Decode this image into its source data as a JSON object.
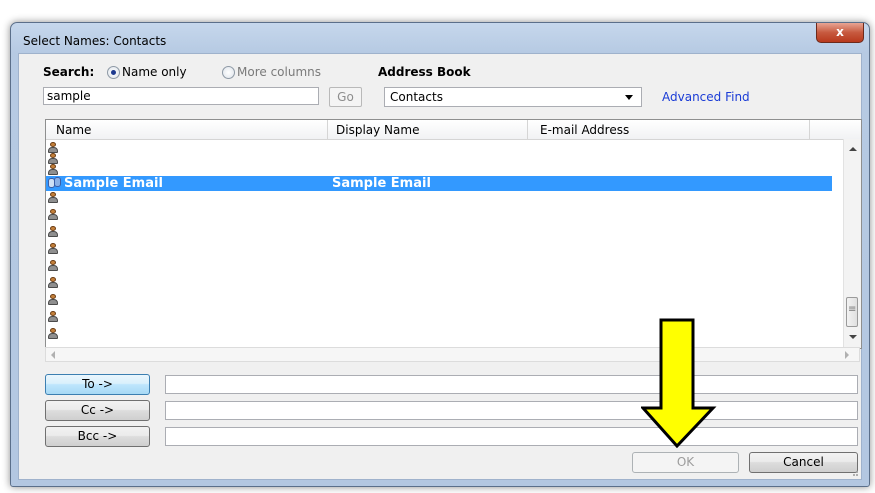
{
  "window": {
    "title": "Select Names: Contacts",
    "close_label": "x"
  },
  "search": {
    "label": "Search:",
    "option_name_only": "Name only",
    "option_more_columns": "More columns",
    "value": "sample",
    "go_label": "Go"
  },
  "address_book": {
    "label": "Address Book",
    "selected": "Contacts",
    "advanced_find": "Advanced Find"
  },
  "table": {
    "columns": [
      "Name",
      "Display Name",
      "E-mail Address"
    ],
    "selected_row": {
      "name": "Sample Email",
      "display_name": "Sample Email"
    }
  },
  "recipients": {
    "to_label": "To ->",
    "cc_label": "Cc ->",
    "bcc_label": "Bcc ->"
  },
  "footer": {
    "ok_label": "OK",
    "cancel_label": "Cancel"
  },
  "colors": {
    "selection": "#3399ff",
    "annotation_arrow": "#ffff00",
    "link": "#1a3bd6"
  }
}
